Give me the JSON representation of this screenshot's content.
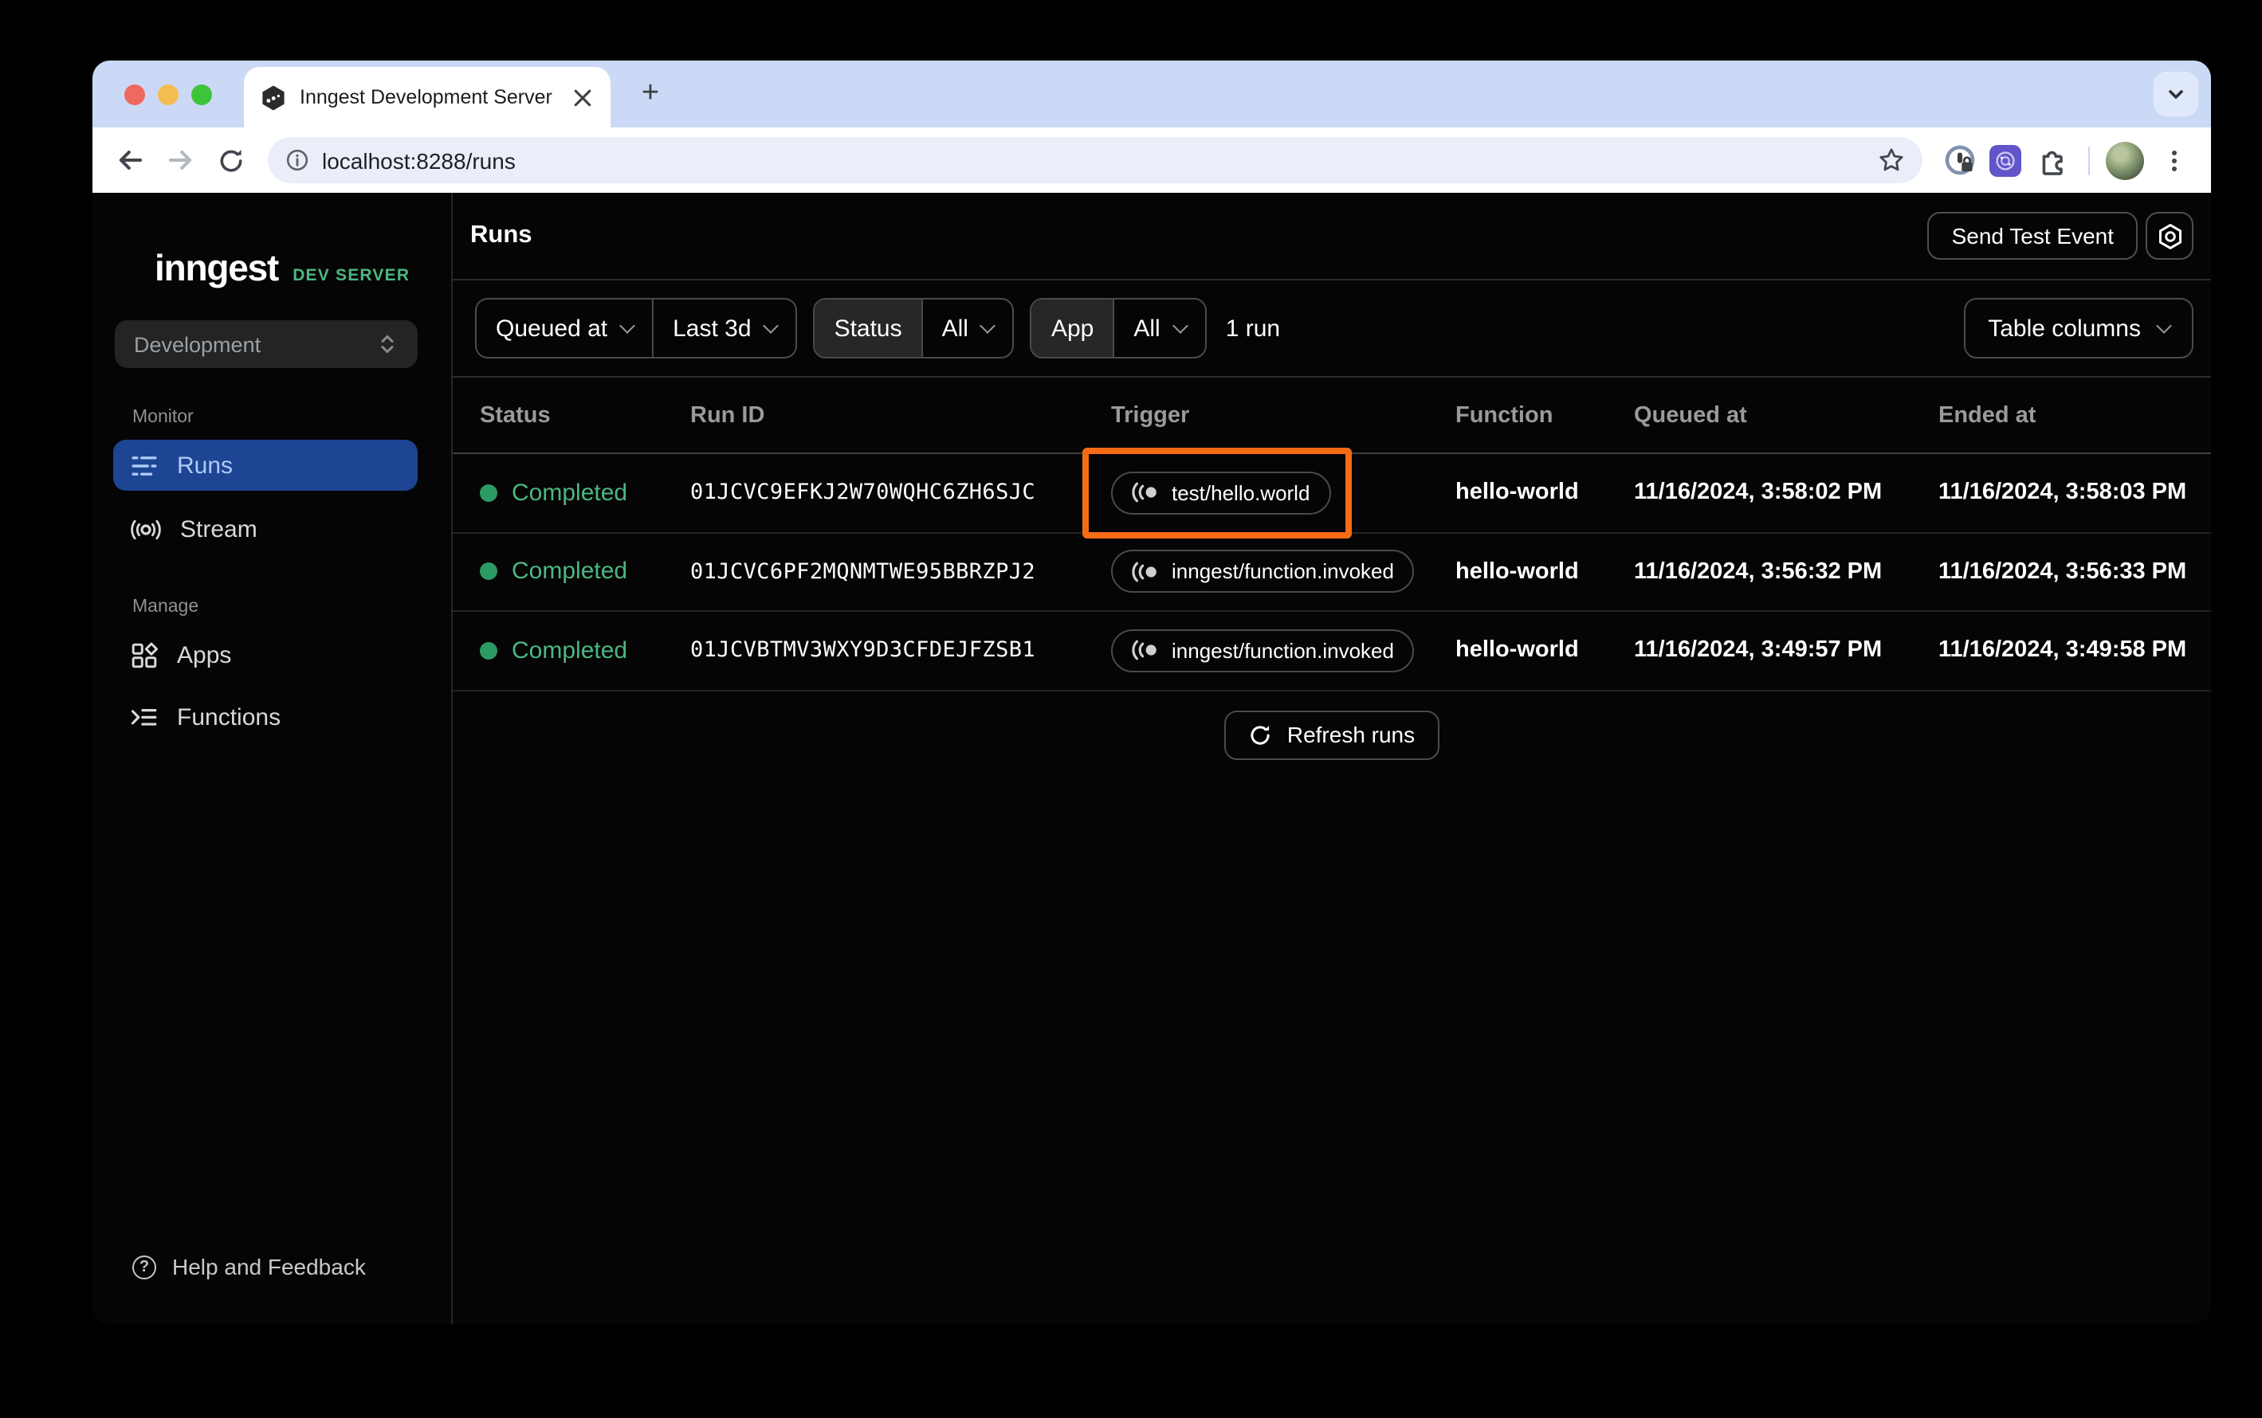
{
  "browser": {
    "tab_title": "Inngest Development Server",
    "url": "localhost:8288/runs",
    "new_tab_glyph": "+"
  },
  "sidebar": {
    "logo_text": "inngest",
    "logo_badge": "DEV SERVER",
    "env_selector_value": "Development",
    "section_monitor_label": "Monitor",
    "nav_runs_label": "Runs",
    "nav_stream_label": "Stream",
    "section_manage_label": "Manage",
    "nav_apps_label": "Apps",
    "nav_functions_label": "Functions",
    "help_label": "Help and Feedback",
    "help_glyph": "?"
  },
  "header": {
    "title": "Runs",
    "send_test_event_label": "Send Test Event"
  },
  "filters": {
    "time_field_label": "Queued at",
    "time_range_label": "Last 3d",
    "status_label": "Status",
    "status_value": "All",
    "app_label": "App",
    "app_value": "All",
    "run_count": "1 run",
    "table_columns_label": "Table columns"
  },
  "table": {
    "columns": [
      "Status",
      "Run ID",
      "Trigger",
      "Function",
      "Queued at",
      "Ended at"
    ],
    "rows": [
      {
        "status": "Completed",
        "run_id": "01JCVC9EFKJ2W70WQHC6ZH6SJC",
        "trigger": "test/hello.world",
        "function": "hello-world",
        "queued_at": "11/16/2024, 3:58:02 PM",
        "ended_at": "11/16/2024, 3:58:03 PM",
        "highlighted": true
      },
      {
        "status": "Completed",
        "run_id": "01JCVC6PF2MQNMTWE95BBRZPJ2",
        "trigger": "inngest/function.invoked",
        "function": "hello-world",
        "queued_at": "11/16/2024, 3:56:32 PM",
        "ended_at": "11/16/2024, 3:56:33 PM",
        "highlighted": false
      },
      {
        "status": "Completed",
        "run_id": "01JCVBTMV3WXY9D3CFDEJFZSB1",
        "trigger": "inngest/function.invoked",
        "function": "hello-world",
        "queued_at": "11/16/2024, 3:49:57 PM",
        "ended_at": "11/16/2024, 3:49:58 PM",
        "highlighted": false
      }
    ],
    "refresh_label": "Refresh runs"
  },
  "colors": {
    "tab_strip": "#ccd9f6",
    "accent_green": "#4cb782",
    "status_completed_dot": "#2c9b63",
    "active_nav_bg": "#1e4594",
    "active_nav_fg": "#aecbf7",
    "highlight_orange": "#f76b15",
    "page_bg": "#050505"
  },
  "icons": {
    "favicon": "inngest-hexagon-logo",
    "trigger": "event-pulse-icon",
    "settings": "hex-nut-settings-icon"
  }
}
